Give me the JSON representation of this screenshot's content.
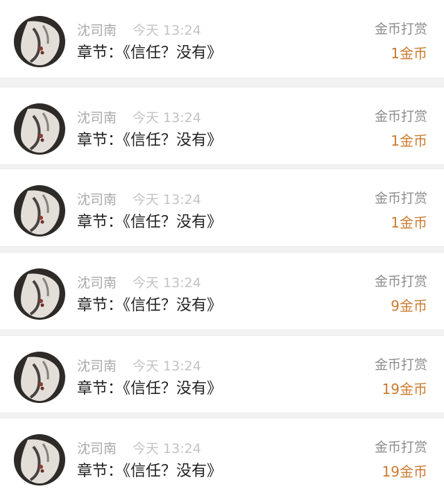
{
  "items": [
    {
      "name": "沈司南",
      "time": "今天 13:24",
      "chapter": "章节：《信任？没有》",
      "type": "金币打赏",
      "amount": "1金币"
    },
    {
      "name": "沈司南",
      "time": "今天 13:24",
      "chapter": "章节：《信任？没有》",
      "type": "金币打赏",
      "amount": "1金币"
    },
    {
      "name": "沈司南",
      "time": "今天 13:24",
      "chapter": "章节：《信任？没有》",
      "type": "金币打赏",
      "amount": "1金币"
    },
    {
      "name": "沈司南",
      "time": "今天 13:24",
      "chapter": "章节：《信任？没有》",
      "type": "金币打赏",
      "amount": "9金币"
    },
    {
      "name": "沈司南",
      "time": "今天 13:24",
      "chapter": "章节：《信任？没有》",
      "type": "金币打赏",
      "amount": "19金币"
    },
    {
      "name": "沈司南",
      "time": "今天 13:24",
      "chapter": "章节：《信任？没有》",
      "type": "金币打赏",
      "amount": "19金币"
    }
  ],
  "colors": {
    "amount": "#cc7a2e",
    "name": "#a9a9a9",
    "time": "#c3c3c3",
    "chapter": "#222222",
    "type": "#8d8d8d"
  },
  "icons": {
    "avatar": "user-avatar-photo"
  }
}
